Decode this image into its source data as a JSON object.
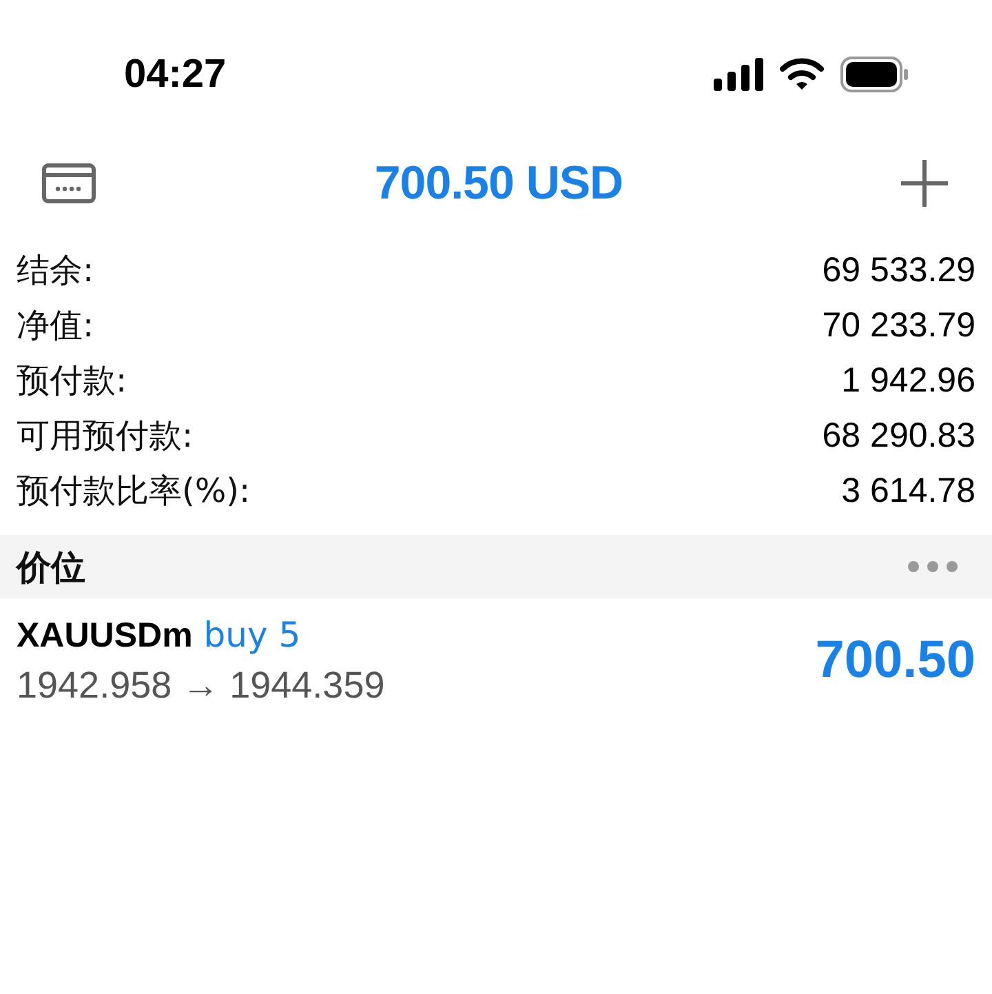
{
  "status_bar": {
    "time": "04:27"
  },
  "header": {
    "title": "700.50 USD"
  },
  "summary": [
    {
      "label": "结余:",
      "value": "69 533.29"
    },
    {
      "label": "净值:",
      "value": "70 233.79"
    },
    {
      "label": "预付款:",
      "value": "1 942.96"
    },
    {
      "label": "可用预付款:",
      "value": "68 290.83"
    },
    {
      "label": "预付款比率(%):",
      "value": "3 614.78"
    }
  ],
  "section": {
    "title": "价位"
  },
  "positions": [
    {
      "symbol": "XAUUSDm",
      "side": "buy 5",
      "kind": "buy",
      "prices": "1942.958 → 1944.359",
      "profit": "700.50",
      "positive": true
    }
  ]
}
